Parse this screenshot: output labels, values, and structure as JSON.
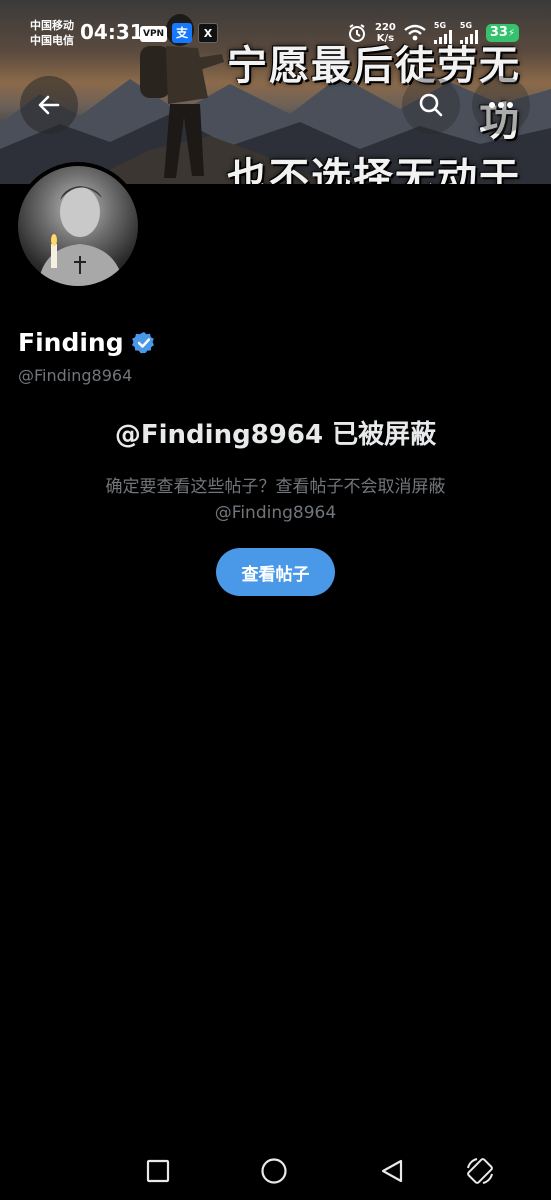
{
  "status_bar": {
    "carrier_1": "中国移动",
    "carrier_2": "中国电信",
    "time": "04:31",
    "vpn_label": "VPN",
    "alipay_glyph": "支",
    "x_glyph": "X",
    "net_speed_value": "220",
    "net_speed_unit": "K/s",
    "signal_1_label": "5G",
    "signal_2_label": "5G",
    "battery_level": "33",
    "icons": [
      "alarm-icon",
      "wifi-icon",
      "signal-icon",
      "signal-icon",
      "battery-icon",
      "charging-icon"
    ]
  },
  "banner": {
    "line_1": "宁愿最后徒劳无功",
    "line_2": "也不选择无动于衷"
  },
  "toolbar": {
    "back_icon": "arrow-left-icon",
    "search_icon": "search-icon",
    "more_icon": "more-icon"
  },
  "profile": {
    "display_name": "Finding",
    "handle": "@Finding8964",
    "verified": true,
    "verified_color": "#4a99e9"
  },
  "blocked": {
    "title": "@Finding8964 已被屏蔽",
    "description_line_1": "确定要查看这些帖子？查看帖子不会取消屏蔽",
    "description_line_2": "@Finding8964",
    "button_label": "查看帖子"
  },
  "colors": {
    "accent": "#4a99e9",
    "background": "#000000",
    "secondary_text": "#71767b",
    "battery": "#36c26c"
  },
  "nav_bar": {
    "icons": [
      "recents-icon",
      "home-icon",
      "back-icon",
      "rotate-icon"
    ]
  }
}
